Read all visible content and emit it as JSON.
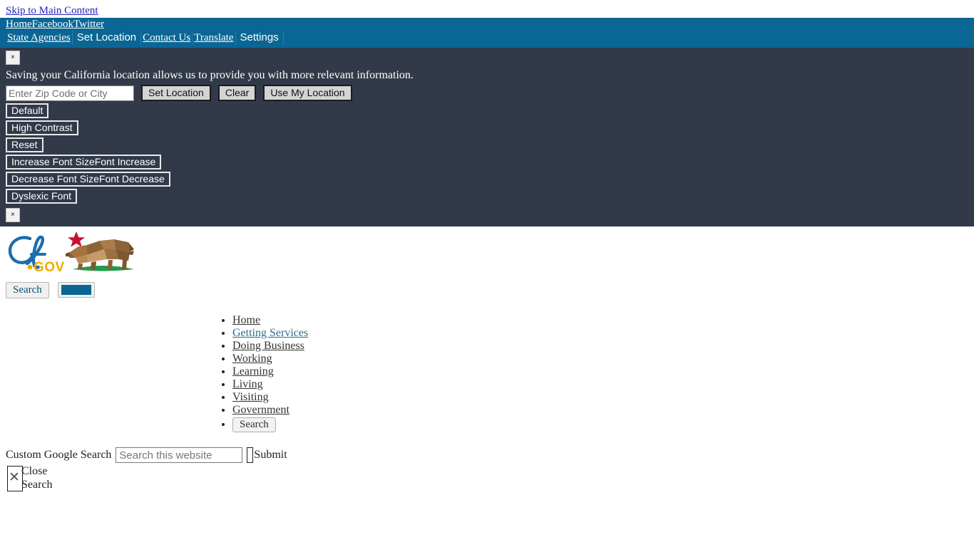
{
  "skip": {
    "label": "Skip to Main Content"
  },
  "utility": {
    "primary_links": [
      {
        "label": "Home"
      },
      {
        "label": "Facebook"
      },
      {
        "label": "Twitter"
      }
    ],
    "secondary": [
      {
        "label": "State Agencies",
        "type": "link"
      },
      {
        "label": "Set Location",
        "type": "button"
      },
      {
        "label": "Contact Us",
        "type": "link"
      },
      {
        "label": "Translate",
        "type": "link"
      },
      {
        "label": "Settings",
        "type": "button"
      }
    ]
  },
  "location_panel": {
    "close_label": "×",
    "message": "Saving your California location allows us to provide you with more relevant information.",
    "input_placeholder": "Enter Zip Code or City",
    "input_value": "",
    "buttons": [
      {
        "label": "Set Location"
      },
      {
        "label": "Clear"
      },
      {
        "label": "Use My Location"
      }
    ]
  },
  "settings_panel": {
    "close_label": "×",
    "buttons": [
      {
        "label": "Default"
      },
      {
        "label": "High Contrast"
      },
      {
        "label": "Reset"
      },
      {
        "label": "Increase Font SizeFont Increase"
      },
      {
        "label": "Decrease Font SizeFont Decrease"
      },
      {
        "label": "Dyslexic Font"
      }
    ]
  },
  "brand": {
    "logo_icon": "ca-gov-logo",
    "logo_text_ca": "CA",
    "logo_text_gov": ".GOV",
    "bear_icon": "california-bear-icon",
    "star_icon": "red-star-icon"
  },
  "header_search": {
    "search_label": "Search",
    "swatch_color": "#0a6694"
  },
  "main_nav": {
    "items": [
      {
        "label": "Home",
        "active": false
      },
      {
        "label": "Getting Services",
        "active": true
      },
      {
        "label": "Doing Business",
        "active": false
      },
      {
        "label": "Working",
        "active": false
      },
      {
        "label": "Learning",
        "active": false
      },
      {
        "label": "Living",
        "active": false
      },
      {
        "label": "Visiting",
        "active": false
      },
      {
        "label": "Government",
        "active": false
      }
    ],
    "search_button_label": "Search"
  },
  "site_search": {
    "label": "Custom Google Search",
    "placeholder": "Search this website",
    "value": "",
    "submit_label": "Submit",
    "close_label": "Close Search",
    "close_icon": "close-x-icon"
  },
  "colors": {
    "nav_blue": "#0a6694",
    "panel_dark": "#323a49",
    "link_blue": "#2222bb",
    "active_nav": "#2e6e8e",
    "gold": "#f5a623",
    "bear_brown": "#8b6239",
    "star_red": "#c8102e",
    "hill_green": "#1f9b4b"
  }
}
